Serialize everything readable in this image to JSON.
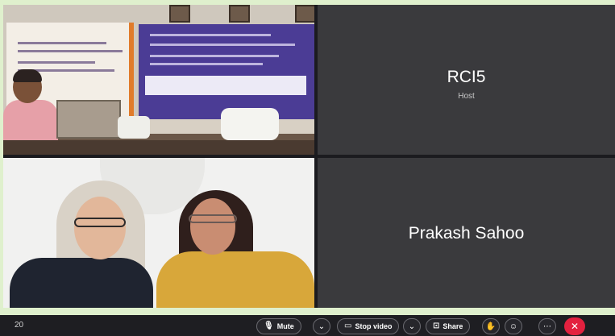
{
  "tiles": [
    {
      "id": "conference-room",
      "kind": "video"
    },
    {
      "id": "rci5",
      "kind": "name",
      "name": "RCI5",
      "role": "Host"
    },
    {
      "id": "two-women",
      "kind": "video"
    },
    {
      "id": "prakash",
      "kind": "name",
      "name": "Prakash Sahoo"
    }
  ],
  "toolbar": {
    "participants_count": "20",
    "mute_label": "Mute",
    "stop_video_label": "Stop video",
    "share_label": "Share",
    "icons": {
      "mute": "microphone-icon",
      "mute_menu": "chevron-down-icon",
      "video": "video-camera-icon",
      "video_menu": "chevron-down-icon",
      "share": "share-screen-icon",
      "raise_hand": "raise-hand-icon",
      "reactions": "emoji-icon",
      "more": "more-options-icon",
      "end": "end-call-icon"
    }
  },
  "colors": {
    "frame_border": "#dff0cd",
    "tile_background": "#3a3a3d",
    "toolbar_background": "#1e1e22",
    "end_call": "#e3213f"
  }
}
